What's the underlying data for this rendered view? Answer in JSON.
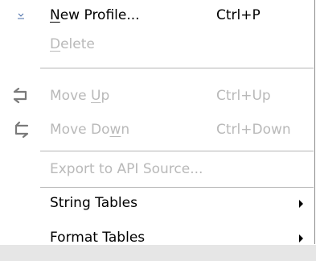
{
  "menu": {
    "items": [
      {
        "label_mnemonic": "N",
        "label_rest": "ew Profile...",
        "shortcut": "Ctrl+P",
        "icon": "new-profile-icon",
        "enabled": true
      },
      {
        "label_mnemonic": "D",
        "label_rest": "elete",
        "shortcut": "",
        "icon": "",
        "enabled": false
      },
      {
        "label_prefix": "Move ",
        "label_mnemonic": "U",
        "label_rest": "p",
        "shortcut": "Ctrl+Up",
        "icon": "move-up-icon",
        "enabled": false
      },
      {
        "label_prefix": "Move Do",
        "label_mnemonic": "w",
        "label_rest": "n",
        "shortcut": "Ctrl+Down",
        "icon": "move-down-icon",
        "enabled": false
      },
      {
        "label": "Export to API Source...",
        "enabled": false
      },
      {
        "label": "String Tables",
        "has_submenu": true,
        "enabled": true
      },
      {
        "label": "Format Tables",
        "has_submenu": true,
        "enabled": true
      }
    ]
  },
  "colors": {
    "enabled_text": "#000000",
    "disabled_text": "#b9b9b9",
    "separator": "#b5b5b5"
  }
}
